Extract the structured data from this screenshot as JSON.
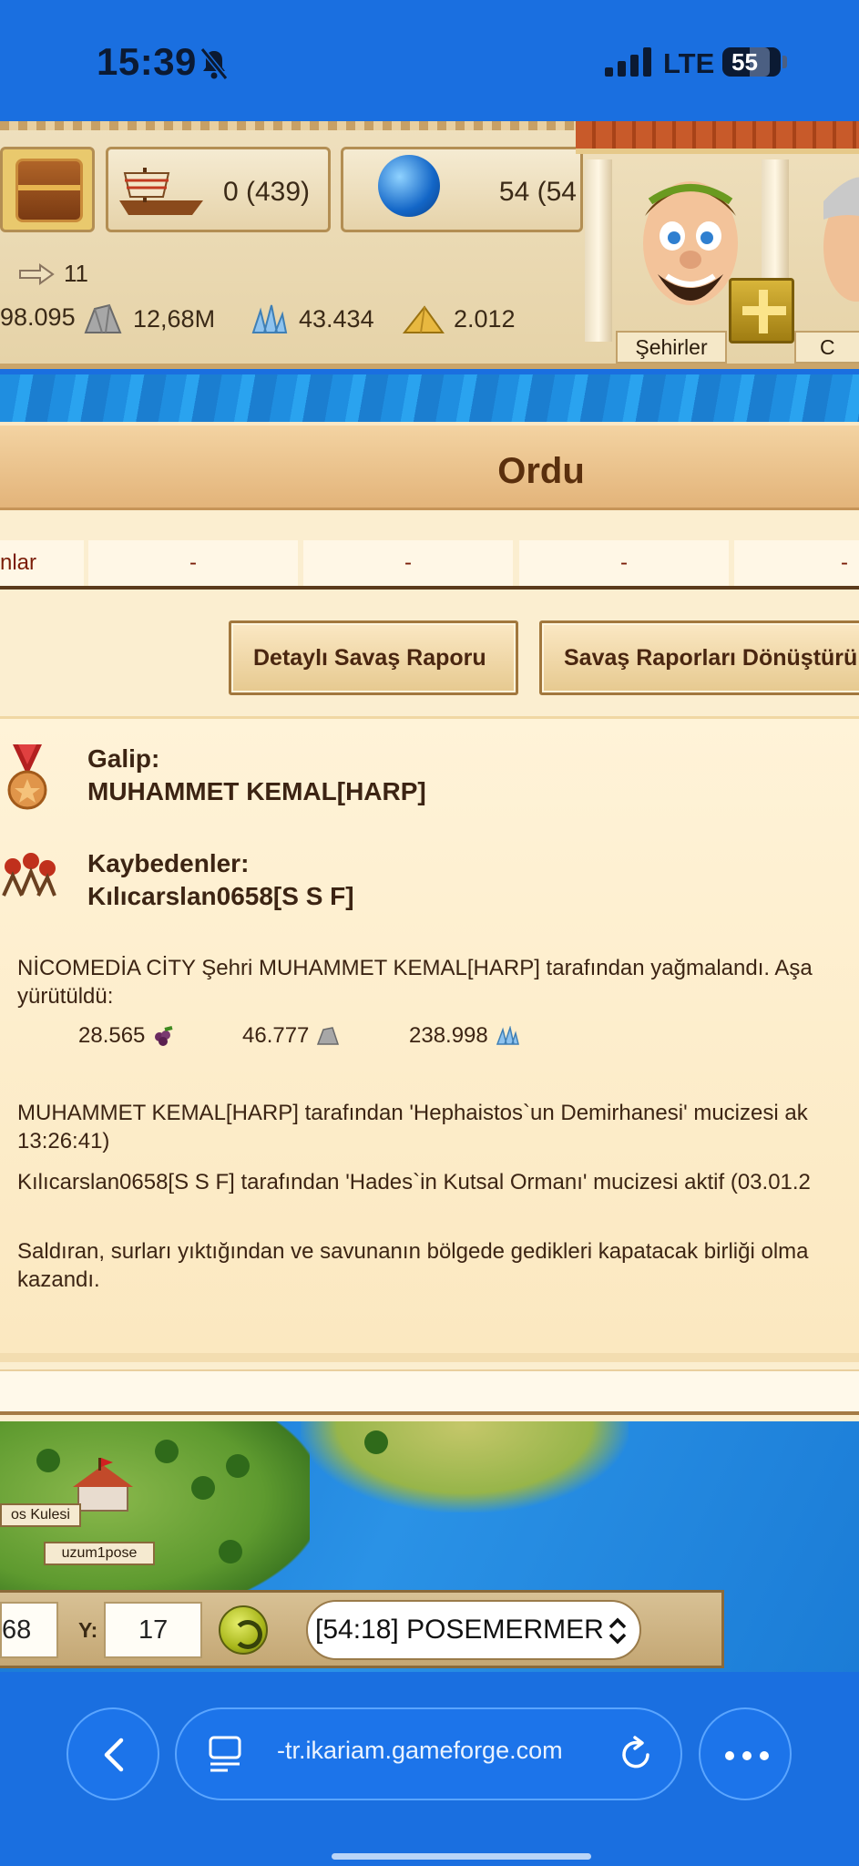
{
  "status_bar": {
    "time": "15:39",
    "network": "LTE",
    "battery": "55"
  },
  "header": {
    "ships": "0 (439)",
    "globe_value": "54 (54",
    "arrow_value": "11",
    "resources": [
      "98.095",
      "12,68M",
      "43.434",
      "2.012"
    ],
    "palace_label": "Şehirler",
    "palace_label2": "C"
  },
  "window": {
    "title": "Ordu",
    "summary_cells": [
      "nlar",
      "-",
      "-",
      "-",
      "-"
    ],
    "buttons": {
      "detail_report": "Detaylı Savaş Raporu",
      "convert_reports": "Savaş Raporları Dönüştürü"
    },
    "report": {
      "winner_label": "Galip:",
      "winner_name": "MUHAMMET KEMAL[HARP]",
      "losers_label": "Kaybedenler:",
      "loser_name": "Kılıcarslan0658[S S F]",
      "plunder_line1": "NİCOMEDİA CİTY Şehri MUHAMMET KEMAL[HARP] tarafından yağmalandı. Aşa",
      "plunder_line2": "yürütüldü:",
      "loot": [
        "28.565",
        "46.777",
        "238.998"
      ],
      "wonder1_line1": "MUHAMMET KEMAL[HARP] tarafından 'Hephaistos`un Demirhanesi' mucizesi ak",
      "wonder1_line2": "13:26:41)",
      "wonder2_line1": "Kılıcarslan0658[S S F] tarafından 'Hades`in Kutsal Ormanı' mucizesi aktif (03.01.2",
      "result_line1": "Saldıran, surları yıktığından ve savunanın bölgede gedikleri kapatacak birliği olma",
      "result_line2": "kazandı."
    }
  },
  "map": {
    "label_tower": "os Kulesi",
    "label_city": "uzum1pose"
  },
  "coords": {
    "x_value": "68",
    "y_label": "Y:",
    "y_value": "17",
    "city_selected": "[54:18] POSEMERMER"
  },
  "browser": {
    "url": "-tr.ikariam.gameforge.com"
  },
  "colors": {
    "safari_blue": "#1A6FE0",
    "title_brown": "#5a2f0d",
    "parchment": "#fbeed0"
  }
}
